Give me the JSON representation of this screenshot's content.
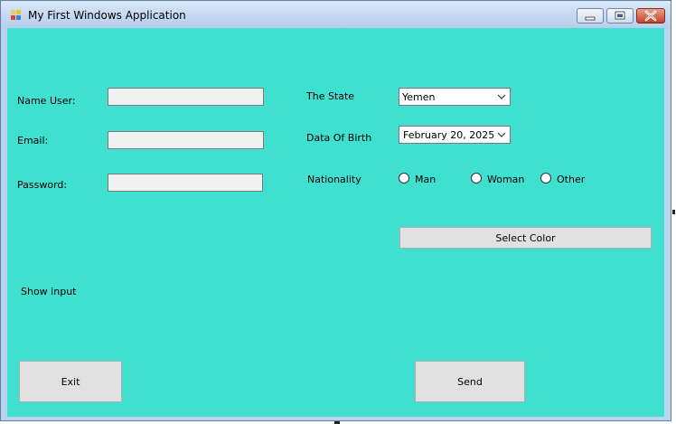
{
  "window": {
    "title": "My First Windows Application",
    "icon": "windows-forms-app-icon",
    "controls": [
      "minimize-icon",
      "maximize-icon",
      "close-icon"
    ],
    "client_color": "#40e0d0"
  },
  "form": {
    "name_label": "Name User:",
    "name_value": "",
    "email_label": "Email:",
    "email_value": "",
    "password_label": "Password:",
    "password_value": "",
    "state_label": "The State",
    "state_value": "Yemen",
    "dob_label": "Data Of Birth",
    "dob_value": "February  20, 2025",
    "nationality_label": "Nationality",
    "nationality_options": [
      "Man",
      "Woman",
      "Other"
    ],
    "select_color_label": "Select Color",
    "show_input_label": "Show input",
    "exit_label": "Exit",
    "send_label": "Send"
  }
}
